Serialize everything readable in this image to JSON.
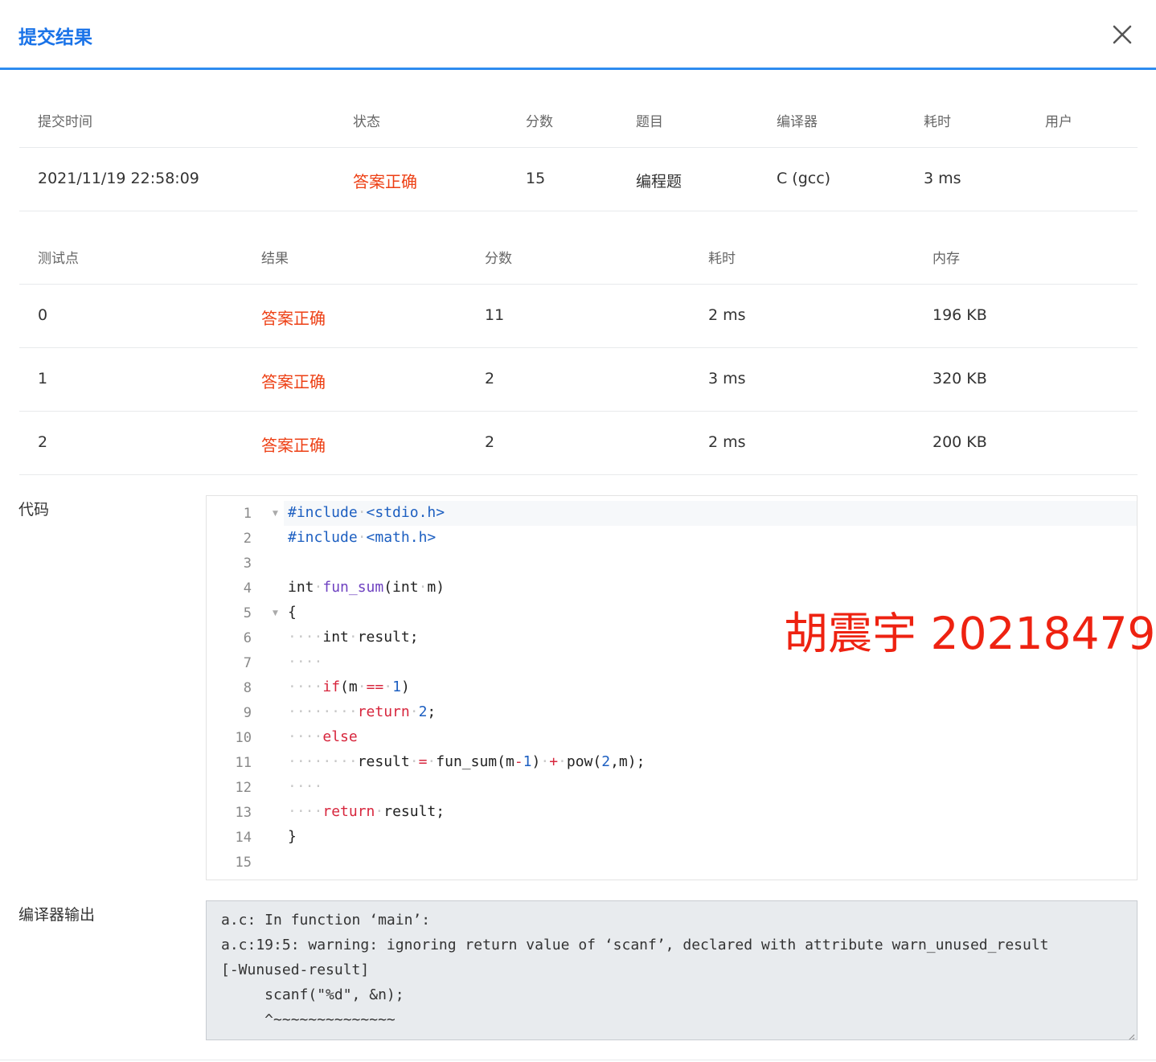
{
  "dialog": {
    "title": "提交结果",
    "close_icon": "close-icon"
  },
  "summary": {
    "headers": [
      "提交时间",
      "状态",
      "分数",
      "题目",
      "编译器",
      "耗时",
      "用户"
    ],
    "row": [
      "2021/11/19 22:58:09",
      "答案正确",
      "15",
      "编程题",
      "C (gcc)",
      "3 ms",
      ""
    ]
  },
  "tests": {
    "headers": [
      "测试点",
      "结果",
      "分数",
      "耗时",
      "内存"
    ],
    "rows": [
      [
        "0",
        "答案正确",
        "11",
        "2 ms",
        "196 KB"
      ],
      [
        "1",
        "答案正确",
        "2",
        "3 ms",
        "320 KB"
      ],
      [
        "2",
        "答案正确",
        "2",
        "2 ms",
        "200 KB"
      ]
    ]
  },
  "code_section": {
    "label": "代码",
    "line_numbers": [
      "1",
      "2",
      "3",
      "4",
      "5",
      "6",
      "7",
      "8",
      "9",
      "10",
      "11",
      "12",
      "13",
      "14",
      "15"
    ],
    "lines": [
      "#include <stdio.h>",
      "#include <math.h>",
      "",
      "int fun_sum(int m)",
      "{",
      "    int result;",
      "    ",
      "    if(m == 1)",
      "        return 2;",
      "    else",
      "        result = fun_sum(m-1) + pow(2,m);",
      "    ",
      "    return result;",
      "}",
      ""
    ]
  },
  "watermark": "胡震宇 20218479",
  "compiler_output": {
    "label": "编译器输出",
    "lines": [
      "a.c: In function ‘main’:",
      "a.c:19:5: warning: ignoring return value of ‘scanf’, declared with attribute warn_unused_result",
      "[-Wunused-result]",
      "     scanf(\"%d\", &n);",
      "     ^~~~~~~~~~~~~~~"
    ]
  },
  "colors": {
    "accent": "#2d8cf0",
    "title": "#1a73e8",
    "success_text": "#ed3f14",
    "watermark": "#ee2211"
  }
}
